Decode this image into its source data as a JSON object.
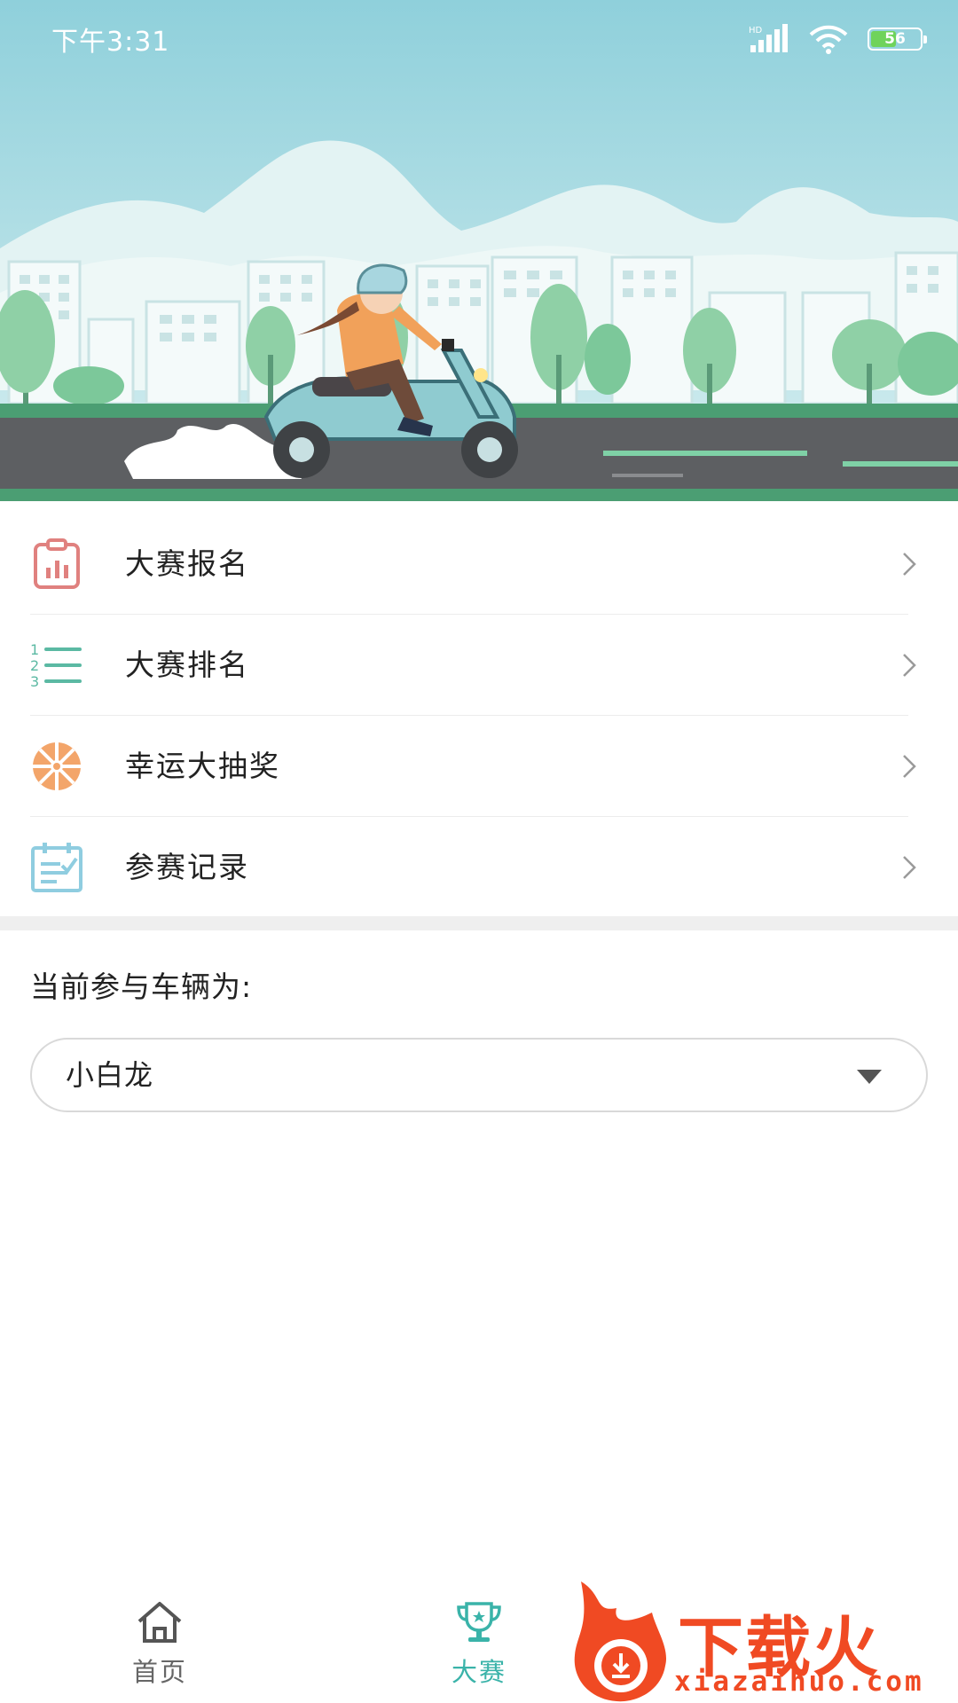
{
  "status_bar": {
    "time": "下午3:31",
    "network": "HD",
    "battery_level": "56",
    "battery_fraction": 0.56,
    "icons": [
      "signal-icon",
      "wifi-icon",
      "battery-icon"
    ]
  },
  "banner": {
    "illustration": "scooter-rider-city-illustration"
  },
  "menu": {
    "items": [
      {
        "label": "大赛报名",
        "icon": "clipboard-chart-icon",
        "color": "#e0817f"
      },
      {
        "label": "大赛排名",
        "icon": "ranking-list-icon",
        "color": "#5bb9a3"
      },
      {
        "label": "幸运大抽奖",
        "icon": "lottery-wheel-icon",
        "color": "#f3a56a"
      },
      {
        "label": "参赛记录",
        "icon": "record-calendar-icon",
        "color": "#8fcde0"
      }
    ]
  },
  "vehicle": {
    "label": "当前参与车辆为:",
    "selected": "小白龙"
  },
  "bottom_nav": {
    "items": [
      {
        "label": "首页",
        "icon": "home-icon",
        "active": false
      },
      {
        "label": "大赛",
        "icon": "trophy-icon",
        "active": true
      }
    ],
    "accent": "#3ab3a9"
  },
  "watermark": {
    "text": "下载火",
    "url": "xiazaihuo.com"
  }
}
